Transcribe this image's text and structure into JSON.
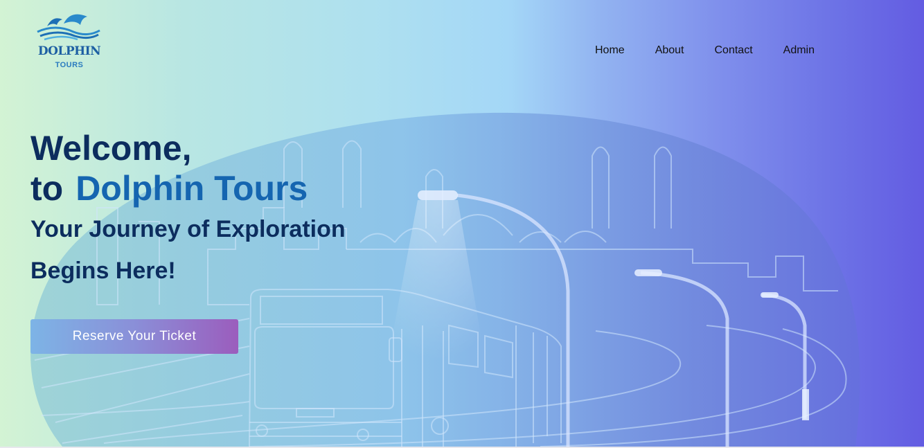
{
  "brand": {
    "name": "DOLPHIN",
    "sub": "TOURS"
  },
  "nav": {
    "items": [
      "Home",
      "About",
      "Contact",
      "Admin"
    ]
  },
  "hero": {
    "line1": "Welcome,",
    "line2_prefix": "to",
    "line2_brand": "Dolphin Tours",
    "line3": "Your Journey of Exploration",
    "line4": "Begins Here!",
    "cta_label": "Reserve Your Ticket"
  },
  "colors": {
    "heading": "#0c2d5e",
    "brand_accent": "#1565b0",
    "cta_start": "#7db4e6",
    "cta_end": "#9b5dbd"
  }
}
